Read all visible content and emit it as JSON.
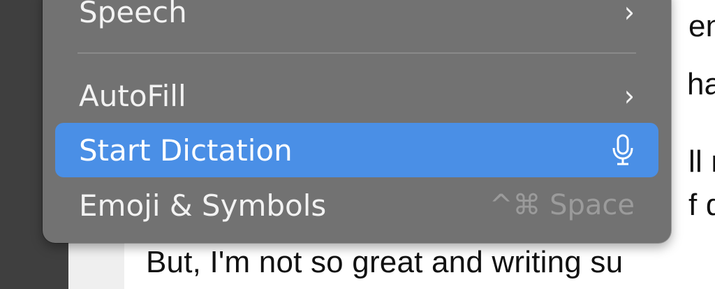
{
  "document": {
    "lines": [
      {
        "text": "eng"
      },
      {
        "text": "has"
      },
      {
        "text": "ll m"
      },
      {
        "text": "f d"
      },
      {
        "text": "But, I'm not so great and writing su"
      }
    ]
  },
  "context_menu": {
    "items": [
      {
        "label": "Speech",
        "submenu": true
      },
      {
        "label": "AutoFill",
        "submenu": true
      },
      {
        "label": "Start Dictation",
        "icon": "microphone-icon",
        "highlighted": true
      },
      {
        "label": "Emoji & Symbols",
        "shortcut": "^⌘ Space"
      }
    ]
  },
  "colors": {
    "menu_background": "#727272",
    "highlight": "#4a8fe6",
    "shortcut_text": "#9b9b9b"
  }
}
